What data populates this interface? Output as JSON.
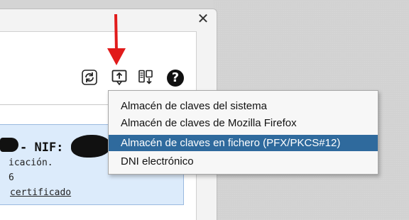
{
  "window": {
    "close_glyph": "✕"
  },
  "toolbar": {
    "icons": [
      "refresh-icon",
      "import-icon",
      "export-icon",
      "help-icon"
    ],
    "help_glyph": "?"
  },
  "certificate": {
    "title_fragment": "- NIF:",
    "line1": "icación.",
    "line2": "6",
    "link_fragment": "certificado"
  },
  "menu": {
    "items": [
      {
        "label": "Almacén de claves del sistema",
        "selected": false
      },
      {
        "label": "Almacén de claves de Mozilla Firefox",
        "selected": false
      },
      {
        "label": "Almacén de claves en fichero (PFX/PKCS#12)",
        "selected": true
      },
      {
        "label": "DNI electrónico",
        "selected": false
      }
    ]
  },
  "colors": {
    "selection": "#2f6a9d",
    "annotation_arrow": "#e11b1b",
    "cert_panel": "#dcebfb"
  }
}
